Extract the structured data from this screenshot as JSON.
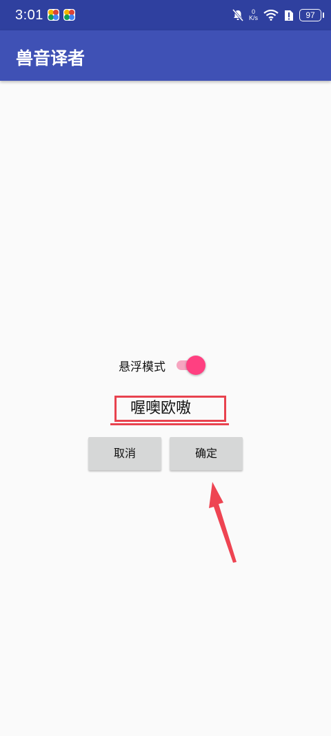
{
  "status_bar": {
    "time": "3:01",
    "speed_value": "0",
    "speed_unit": "K/s",
    "battery": "97"
  },
  "app_bar": {
    "title": "兽音译者"
  },
  "floating_mode": {
    "label": "悬浮模式",
    "enabled": true
  },
  "input": {
    "value": "喔噢欧嗷"
  },
  "buttons": {
    "cancel": "取消",
    "confirm": "确定"
  },
  "colors": {
    "status_bar": "#2f409f",
    "app_bar": "#3f51b5",
    "accent": "#ff4081",
    "annotation": "#e8424e"
  }
}
